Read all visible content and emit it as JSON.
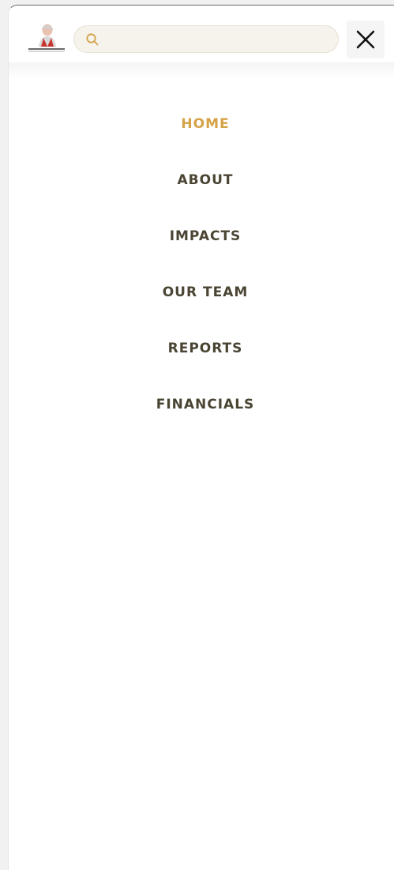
{
  "header": {
    "logo_alt": "Foundation logo",
    "search": {
      "value": "",
      "placeholder": ""
    },
    "close_label": "Close menu"
  },
  "menu": {
    "items": [
      {
        "label": "HOME",
        "active": true
      },
      {
        "label": "ABOUT",
        "active": false
      },
      {
        "label": "IMPACTS",
        "active": false
      },
      {
        "label": "OUR TEAM",
        "active": false
      },
      {
        "label": "REPORTS",
        "active": false
      },
      {
        "label": "FINANCIALS",
        "active": false
      }
    ]
  },
  "colors": {
    "accent": "#d4a247",
    "menu_text": "#4a4433",
    "search_bg": "#f6f3ec",
    "close_bg": "#f5f5f5"
  },
  "icons": {
    "search": "search-icon",
    "close": "close-icon",
    "logo": "portrait-logo-icon"
  }
}
